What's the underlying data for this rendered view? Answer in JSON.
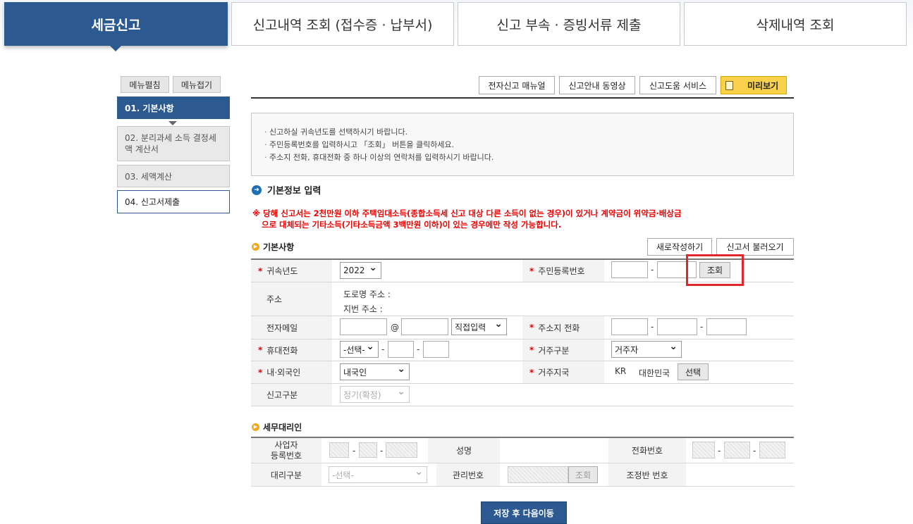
{
  "top_tabs": [
    {
      "label": "세금신고"
    },
    {
      "label": "신고내역 조회 (접수증 · 납부서)"
    },
    {
      "label": "신고 부속 · 증빙서류 제출"
    },
    {
      "label": "삭제내역 조회"
    }
  ],
  "sidebar": {
    "expand_label": "메뉴펼침",
    "collapse_label": "메뉴접기",
    "steps": [
      {
        "label": "01. 기본사항"
      },
      {
        "label": "02. 분리과세 소득 결정세액 계산서"
      },
      {
        "label": "03. 세액계산"
      },
      {
        "label": "04. 신고서제출"
      }
    ]
  },
  "toolbar": {
    "manual": "전자신고 매뉴얼",
    "video": "신고안내 동영상",
    "help": "신고도움 서비스",
    "preview": "미리보기"
  },
  "notice": [
    "신고하실 귀속년도를 선택하시기 바랍니다.",
    "주민등록번호를 입력하시고 「조회」 버튼을 클릭하세요.",
    "주소지 전화, 휴대전화 중 하나 이상의 연락처를 입력하시기 바랍니다."
  ],
  "section_title": "기본정보 입력",
  "warning": [
    "※ 당해 신고서는 2천만원 이하 주택임대소득(종합소득세 신고 대상 다른 소득이 없는 경우)이 있거나 계약금이 위약금·배상금",
    "으로 대체되는 기타소득(기타소득금액 3백만원 이하)이 있는 경우에만 작성 가능합니다."
  ],
  "basic": {
    "title": "기본사항",
    "new_button": "새로작성하기",
    "load_button": "신고서 불러오기",
    "year_label": "귀속년도",
    "year_value": "2022",
    "rrn_label": "주민등록번호",
    "rrn_dash": "-",
    "lookup_button": "조회",
    "address_label": "주소",
    "road_address": "도로명 주소 :",
    "lot_address": "지번 주소 :",
    "email_label": "전자메일",
    "email_at": "@",
    "email_domain_select": "직접입력",
    "home_phone_label": "주소지 전화",
    "mobile_label": "휴대전화",
    "mobile_select": "-선택-",
    "residence_type_label": "거주구분",
    "residence_type_value": "거주자",
    "nationality_label": "내·외국인",
    "nationality_value": "내국인",
    "residence_country_label": "거주지국",
    "country_code": "KR",
    "country_name": "대한민국",
    "country_select_button": "선택",
    "report_type_label": "신고구분",
    "report_type_value": "정기(확정)"
  },
  "agent": {
    "title": "세무대리인",
    "bizno_label": "사업자\n등록번호",
    "name_label": "성명",
    "phone_label": "전화번호",
    "type_label": "대리구분",
    "type_select": "-선택-",
    "manage_no_label": "관리번호",
    "lookup_button": "조회",
    "adjust_no_label": "조정반 번호",
    "dash": "-"
  },
  "save_button": "저장 후 다음이동",
  "colors": {
    "primary": "#2c5a90",
    "warning": "#e00000",
    "highlight_box": "#e0262c",
    "preview_button": "#f9d14a"
  }
}
